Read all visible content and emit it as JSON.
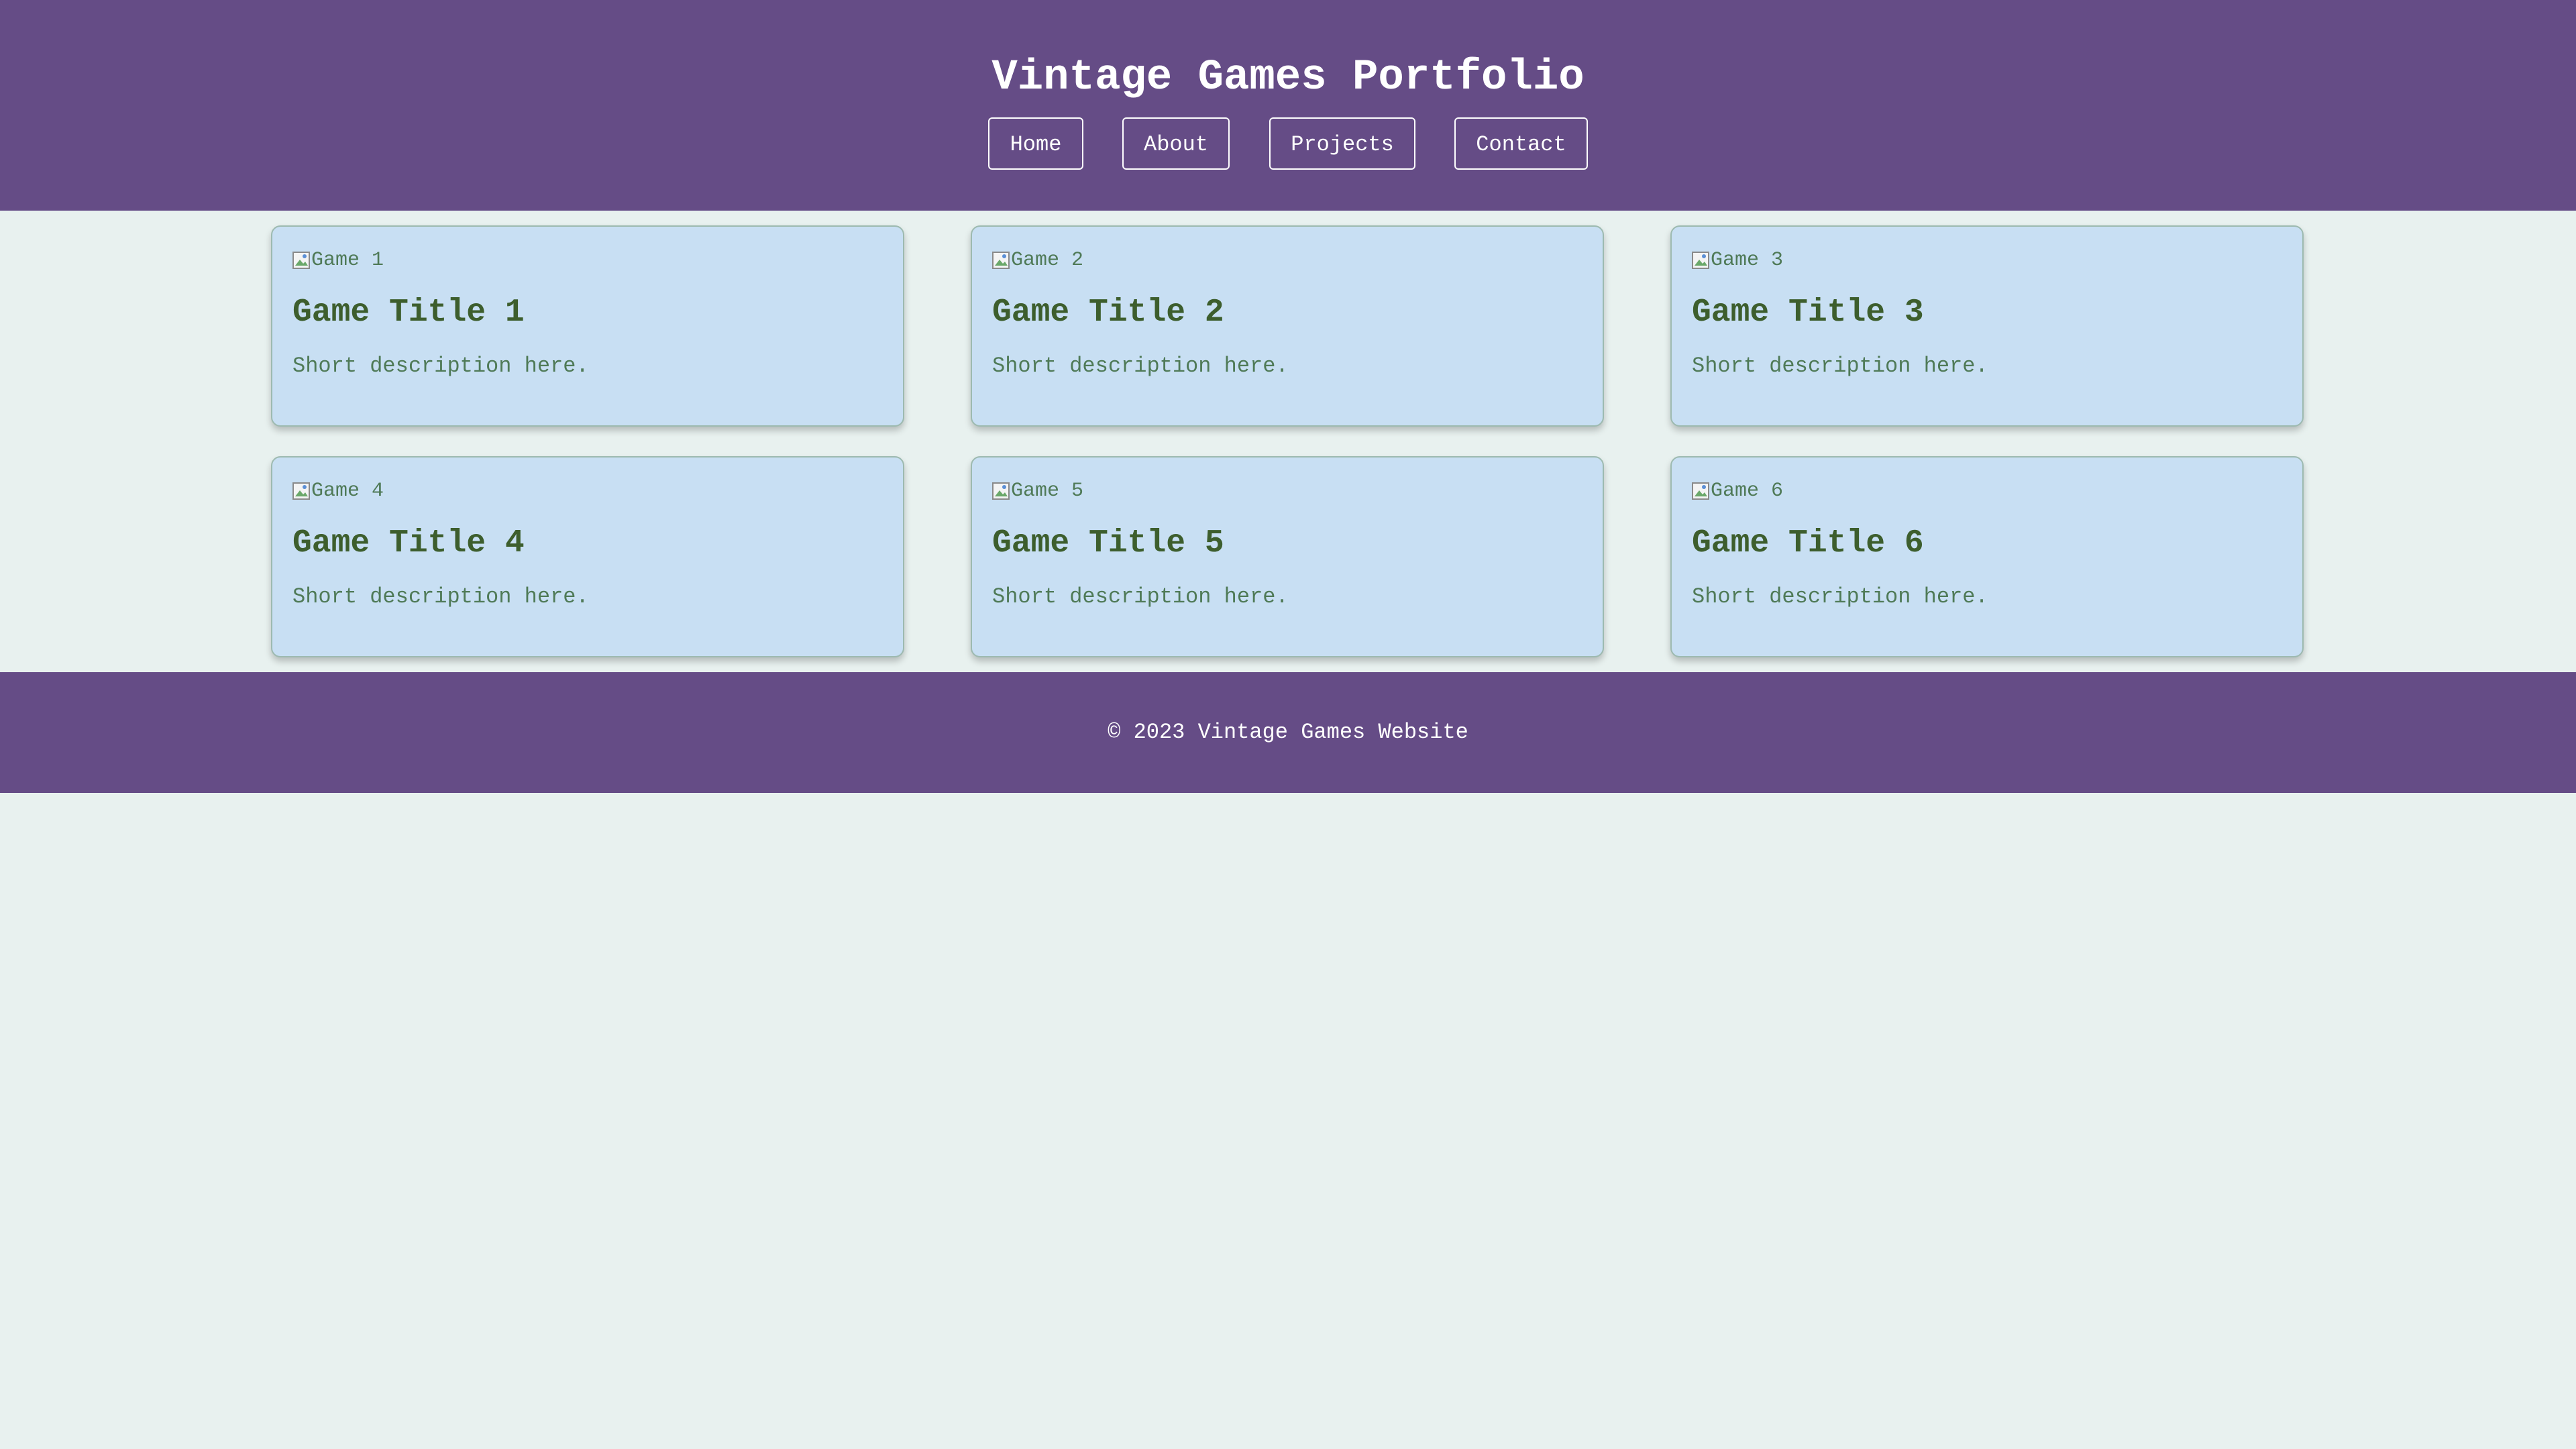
{
  "header": {
    "title": "Vintage Games Portfolio",
    "nav": [
      {
        "label": "Home"
      },
      {
        "label": "About"
      },
      {
        "label": "Projects"
      },
      {
        "label": "Contact"
      }
    ]
  },
  "cards": [
    {
      "image_alt": "Game 1",
      "title": "Game Title 1",
      "description": "Short description here."
    },
    {
      "image_alt": "Game 2",
      "title": "Game Title 2",
      "description": "Short description here."
    },
    {
      "image_alt": "Game 3",
      "title": "Game Title 3",
      "description": "Short description here."
    },
    {
      "image_alt": "Game 4",
      "title": "Game Title 4",
      "description": "Short description here."
    },
    {
      "image_alt": "Game 5",
      "title": "Game Title 5",
      "description": "Short description here."
    },
    {
      "image_alt": "Game 6",
      "title": "Game Title 6",
      "description": "Short description here."
    }
  ],
  "footer": {
    "text": "© 2023 Vintage Games Website"
  },
  "colors": {
    "header_bg": "#654c86",
    "page_bg": "#e8f1ef",
    "card_bg": "#c8dff3",
    "title_text": "#3d5e2d",
    "body_text": "#4f7a57"
  },
  "icons": {
    "card_image": "broken-image-icon"
  }
}
